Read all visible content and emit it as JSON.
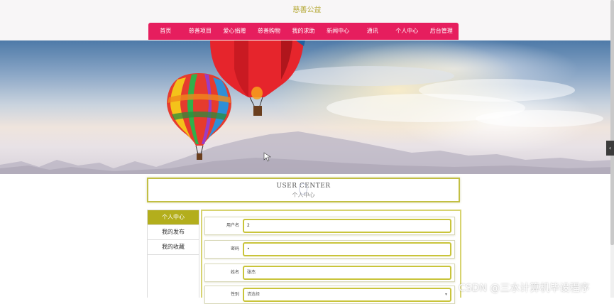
{
  "site": {
    "title": "慈善公益"
  },
  "nav": {
    "items": [
      {
        "label": "首页"
      },
      {
        "label": "慈善项目"
      },
      {
        "label": "爱心捐赠"
      },
      {
        "label": "慈善购物"
      },
      {
        "label": "我的求助"
      },
      {
        "label": "新闻中心"
      },
      {
        "label": "通讯"
      },
      {
        "label": "个人中心"
      },
      {
        "label": "后台管理"
      }
    ]
  },
  "banner": {
    "slides": 3,
    "active_slide": 1
  },
  "user_center": {
    "title_en": "USER CENTER",
    "title_cn": "个人中心"
  },
  "sidebar": {
    "items": [
      {
        "label": "个人中心",
        "active": true
      },
      {
        "label": "我的发布",
        "active": false
      },
      {
        "label": "我的收藏",
        "active": false
      }
    ]
  },
  "form": {
    "username": {
      "label": "用户名",
      "value": "2"
    },
    "password": {
      "label": "密码",
      "value": "•"
    },
    "name": {
      "label": "姓名",
      "value": "张杰"
    },
    "gender": {
      "label": "性别",
      "value": "请选择"
    }
  },
  "watermark": "CSDN @三水计算机毕设程序",
  "colors": {
    "nav_bg": "#e61e5e",
    "accent": "#b3ae1c",
    "title": "#b5a834"
  },
  "icons": {
    "side_arrow": "chevron-left-icon"
  }
}
